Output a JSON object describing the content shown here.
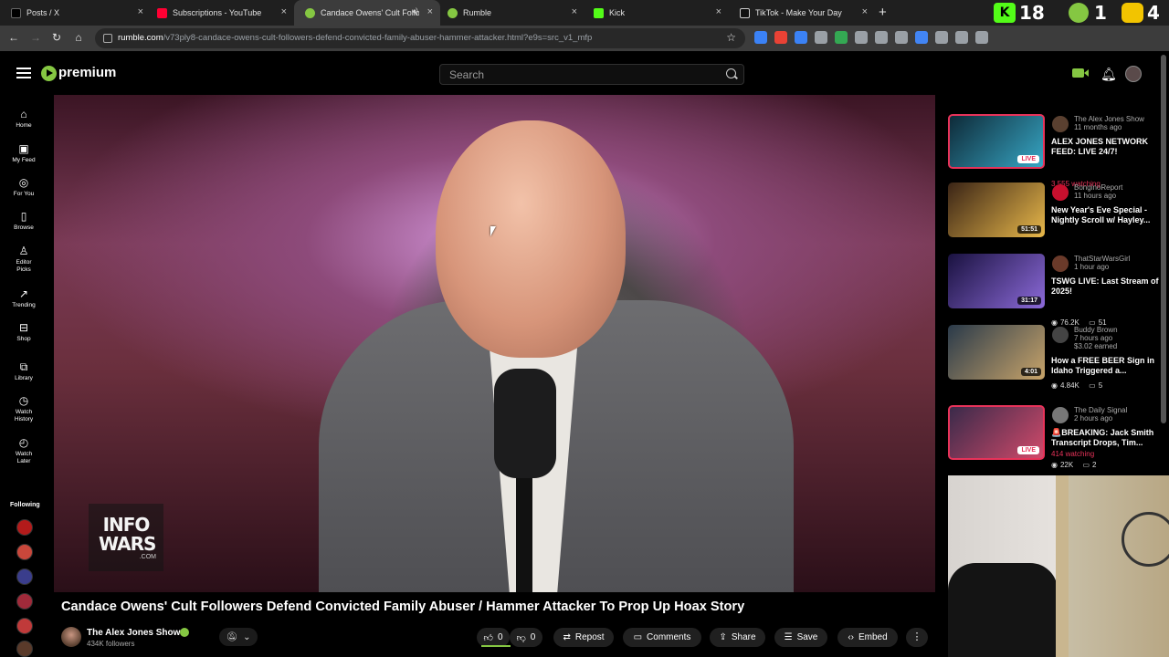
{
  "browser": {
    "tabs": [
      {
        "label": "Posts / X",
        "favicon_color": "#000000"
      },
      {
        "label": "Subscriptions - YouTube",
        "favicon_color": "#ff0033"
      },
      {
        "label": "Candace Owens' Cult Follo",
        "favicon_color": "#85c742",
        "active": true
      },
      {
        "label": "Rumble",
        "favicon_color": "#85c742"
      },
      {
        "label": "Kick",
        "favicon_color": "#53fc18"
      },
      {
        "label": "TikTok - Make Your Day",
        "favicon_color": "#ffffff"
      }
    ],
    "new_tab": "+",
    "tab_close_glyph": "×",
    "overlay_counters": {
      "kick": "18",
      "rumble": "1",
      "other": "4"
    },
    "url_host": "rumble.com",
    "url_path": "/v73ply8-candace-owens-cult-followers-defend-convicted-family-abuser-hammer-attacker.html?e9s=src_v1_mfp",
    "extension_colors": [
      "#3b82f6",
      "#e94235",
      "#3b82f6",
      "#9aa0a6",
      "#34a853",
      "#9aa0a6",
      "#9aa0a6",
      "#9aa0a6",
      "#4285f4",
      "#9aa0a6",
      "#9aa0a6",
      "#9aa0a6"
    ]
  },
  "header": {
    "logo_text": "premium",
    "search_placeholder": "Search"
  },
  "nav": {
    "items": [
      {
        "label": "Home",
        "icon": "home-icon"
      },
      {
        "label": "My Feed",
        "icon": "feed-icon"
      },
      {
        "label": "For You",
        "icon": "for-you-icon"
      },
      {
        "label": "Browse",
        "icon": "browse-icon"
      },
      {
        "label": "Editor Picks",
        "icon": "editor-picks-icon"
      },
      {
        "label": "Trending",
        "icon": "trending-icon"
      },
      {
        "label": "Shop",
        "icon": "shop-icon"
      },
      {
        "label": "Library",
        "icon": "library-icon"
      },
      {
        "label": "Watch History",
        "icon": "history-icon"
      },
      {
        "label": "Watch Later",
        "icon": "watch-later-icon"
      }
    ],
    "following_label": "Following",
    "following_colors": [
      "#b31b1b",
      "#c9473b",
      "#3a3d8c",
      "#a02a3a",
      "#c03a3a",
      "#5a3a2a"
    ]
  },
  "video": {
    "overlay_logo": "INFO WARS",
    "overlay_logo_sub": ".COM",
    "title": "Candace Owens' Cult Followers Defend Convicted Family Abuser / Hammer Attacker To Prop Up Hoax Story",
    "channel_name": "The Alex Jones Show",
    "channel_followers": "434K followers",
    "likes": "0",
    "dislikes": "0",
    "actions": {
      "repost": "Repost",
      "comments": "Comments",
      "share": "Share",
      "save": "Save",
      "embed": "Embed"
    },
    "accent": "#85c742"
  },
  "recommendations": [
    {
      "channel": "The Alex Jones Show",
      "age": "11 months ago",
      "title": "ALEX JONES NETWORK FEED: LIVE 24/7!",
      "badge": "LIVE",
      "badge_type": "live",
      "meta": "3,555 watching",
      "meta_type": "watching",
      "thumb": [
        "#0e2a38",
        "#37a6c4"
      ],
      "channel_color": "#5a4030"
    },
    {
      "channel": "BonginoReport",
      "age": "11 hours ago",
      "title": "New Year's Eve Special - Nightly Scroll w/ Hayley...",
      "badge": "51:51",
      "badge_type": "dur",
      "views": "76.2K",
      "comments": "51",
      "thumb": [
        "#3a2416",
        "#e8b84a"
      ],
      "channel_color": "#c8102e"
    },
    {
      "channel": "ThatStarWarsGirl",
      "age": "1 hour ago",
      "title": "TSWG LIVE: Last Stream of 2025!",
      "badge": "31:17",
      "badge_type": "dur",
      "views": "22K",
      "comments": "2",
      "thumb": [
        "#1a1240",
        "#8c6ad9"
      ],
      "channel_color": "#6a3a2a"
    },
    {
      "channel": "Buddy Brown",
      "age": "7 hours ago",
      "earned": "$3.02 earned",
      "title": "How a FREE BEER Sign in Idaho Triggered a...",
      "badge": "4:01",
      "badge_type": "dur",
      "views": "4.84K",
      "comments": "5",
      "thumb": [
        "#2a3a4a",
        "#c8a46a"
      ],
      "channel_color": "#444444"
    },
    {
      "channel": "The Daily Signal",
      "age": "2 hours ago",
      "title": "🚨BREAKING: Jack Smith Transcript Drops, Tim...",
      "badge": "LIVE",
      "badge_type": "live",
      "meta": "414 watching",
      "meta_type": "watching",
      "thumb": [
        "#3a2a4a",
        "#d04a6a"
      ],
      "channel_color": "#777777"
    }
  ]
}
